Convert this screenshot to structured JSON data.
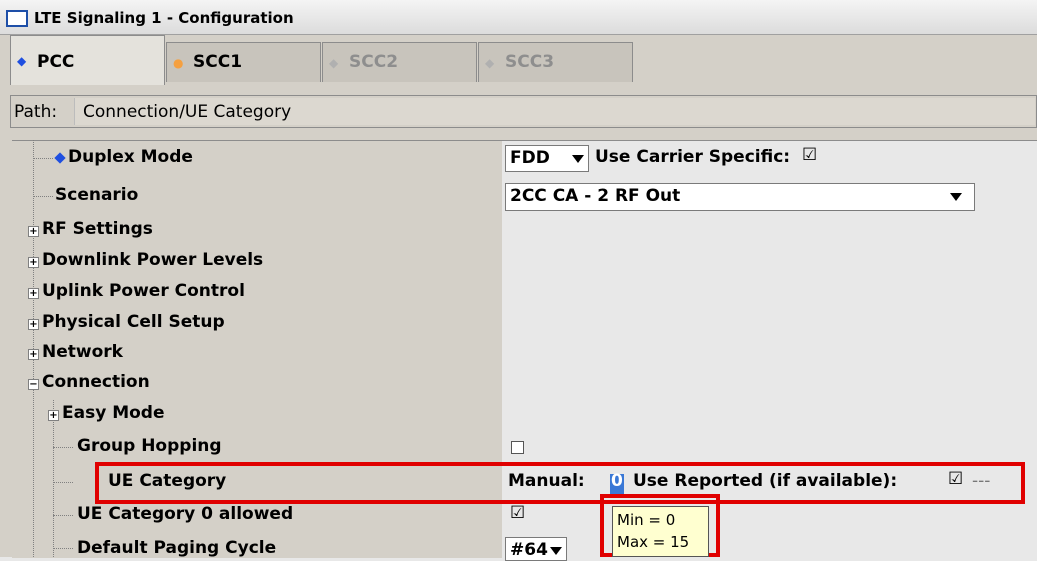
{
  "window": {
    "title": "LTE Signaling 1 - Configuration"
  },
  "tabs": [
    {
      "label": "PCC",
      "dot_color": "#1f4fe0",
      "active": true
    },
    {
      "label": "SCC1",
      "dot_color": "#f5a040",
      "active": false
    },
    {
      "label": "SCC2",
      "dot_color": "#b0b0b0",
      "active": false
    },
    {
      "label": "SCC3",
      "dot_color": "#b0b0b0",
      "active": false
    }
  ],
  "path": {
    "label": "Path:",
    "value": "Connection/UE Category"
  },
  "tree": {
    "duplex_mode": "Duplex Mode",
    "scenario": "Scenario",
    "rf_settings": "RF Settings",
    "downlink_power": "Downlink Power Levels",
    "uplink_power": "Uplink Power Control",
    "physical_cell": "Physical Cell Setup",
    "network": "Network",
    "connection": "Connection",
    "easy_mode": "Easy Mode",
    "group_hopping": "Group Hopping",
    "ue_category": "UE Category",
    "ue_category0": "UE Category 0 allowed",
    "default_paging": "Default Paging Cycle"
  },
  "controls": {
    "duplex_value": "FDD",
    "use_carrier_label": "Use Carrier Specific:",
    "use_carrier_checked": "☑",
    "scenario_value": "2CC CA - 2 RF Out",
    "group_hopping_checked": false,
    "manual_label": "Manual:",
    "manual_value": "0",
    "use_reported_label": "Use Reported (if available):",
    "use_reported_checked": "☑",
    "use_reported_suffix": "---",
    "ue_cat0_checked": "☑",
    "paging_value": "#64"
  },
  "tooltip": {
    "min": "Min = 0",
    "max": "Max = 15"
  },
  "colors": {
    "highlight_red": "#e00000",
    "accent_blue": "#1f4fe0",
    "tooltip_bg": "#ffffd0"
  }
}
